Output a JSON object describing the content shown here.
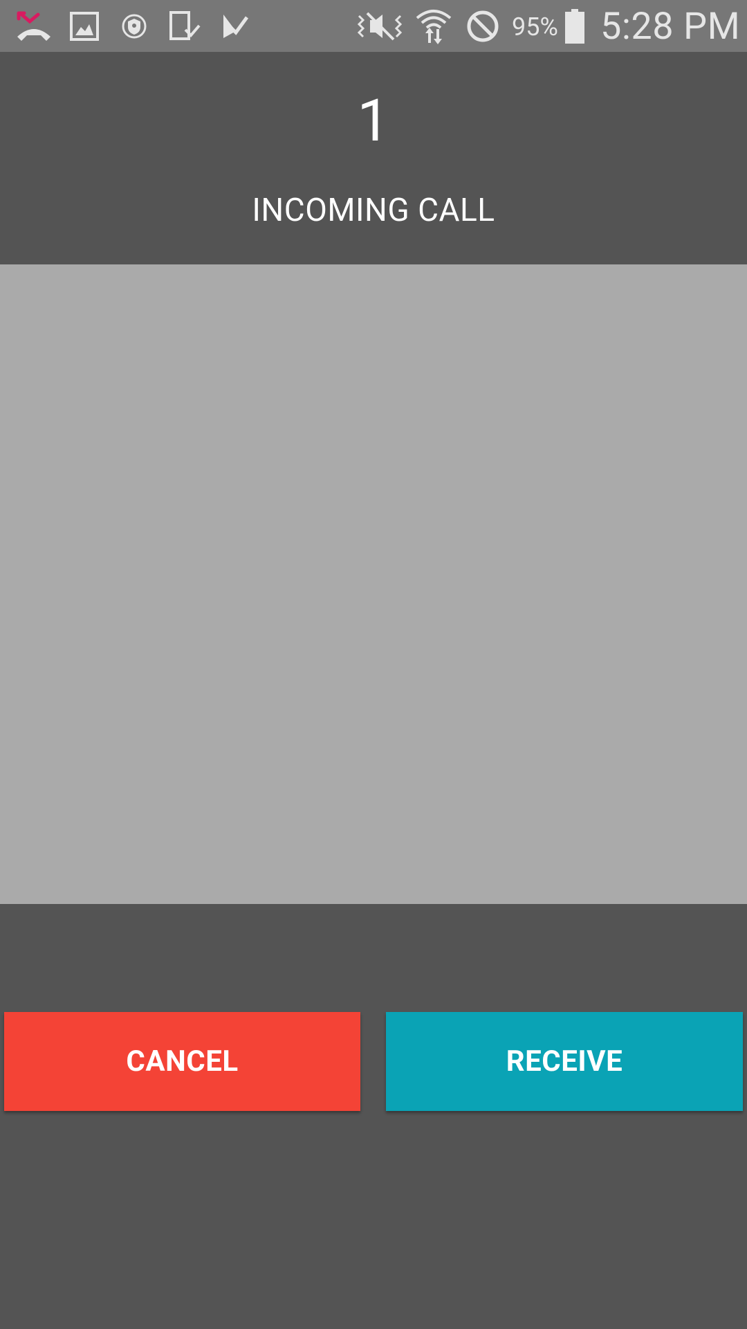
{
  "status_bar": {
    "icons": [
      "missed-call-icon",
      "gallery-icon",
      "shield-icon",
      "tablet-download-icon",
      "play-store-check-icon",
      "vibrate-mute-icon",
      "wifi-icon",
      "do-not-disturb-icon",
      "battery-icon"
    ],
    "battery_percent": "95%",
    "time": "5:28 PM"
  },
  "call": {
    "caller": "1",
    "label": "INCOMING CALL"
  },
  "actions": {
    "cancel_label": "CANCEL",
    "receive_label": "RECEIVE"
  },
  "colors": {
    "status_bar_bg": "#777777",
    "app_bg": "#545454",
    "preview_bg": "#aaaaaa",
    "cancel_bg": "#f44336",
    "receive_bg": "#0aa3b5",
    "missed_call_accent": "#d81b60"
  }
}
